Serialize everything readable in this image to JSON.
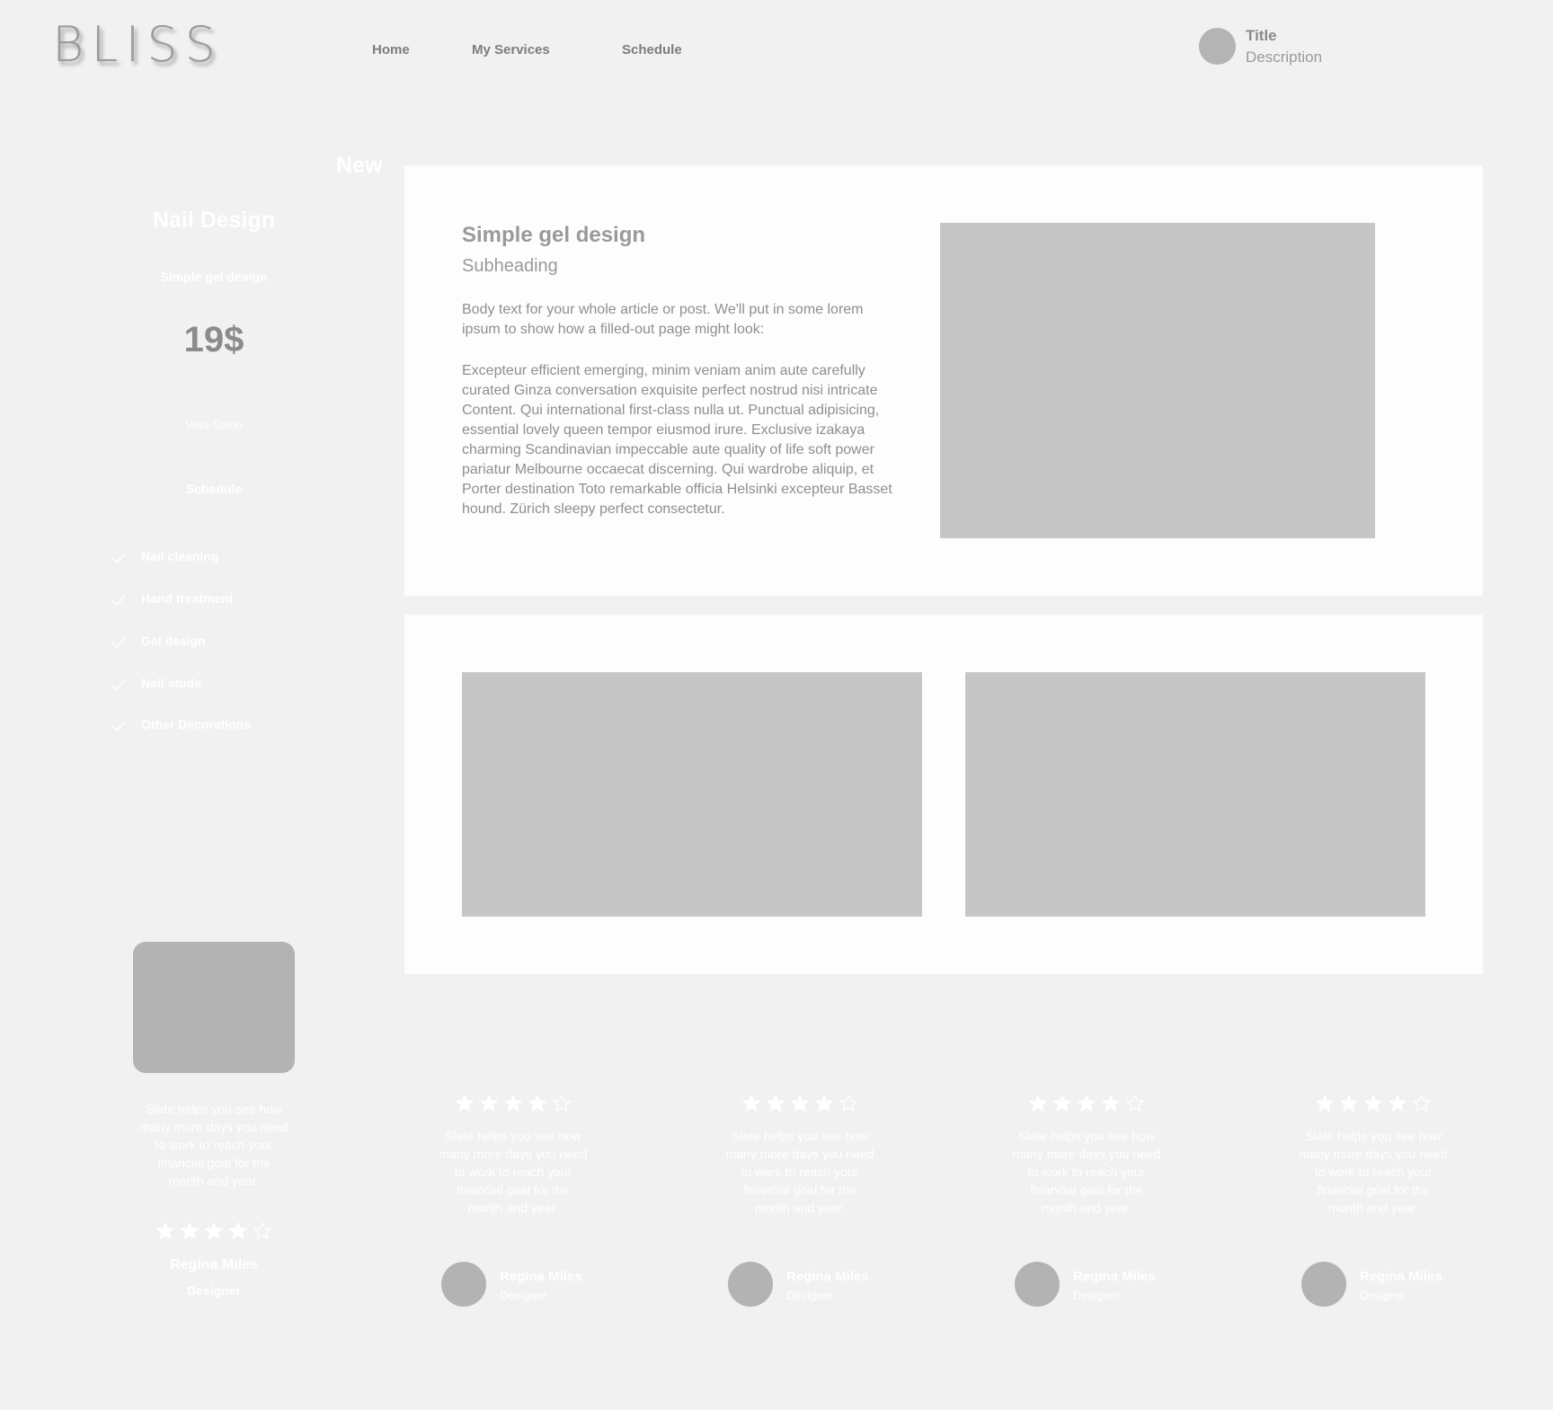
{
  "header": {
    "logo": "BLISS",
    "nav": [
      {
        "label": "Home"
      },
      {
        "label": "My Services"
      },
      {
        "label": "Schedule"
      }
    ],
    "user": {
      "title": "Title",
      "description": "Description"
    }
  },
  "sidebar": {
    "badge": "New",
    "heading": "Nail Design",
    "service": "Simple gel design",
    "price": "19$",
    "salon": "Vera Salon",
    "schedule": "Schedule",
    "features": [
      "Nail cleaning",
      "Hand treatment",
      "Gel design",
      "Nail studs",
      "Other Decorations"
    ],
    "testimonial": {
      "text": "Slate helps you see how many more days you need to work to reach your financial goal for the month and year.",
      "rating": 4,
      "rating_max": 5,
      "name": "Regina Miles",
      "role": "Designer"
    }
  },
  "article": {
    "title": "Simple gel design",
    "subheading": "Subheading",
    "body1": "Body text for your whole article or post. We'll put in some lorem ipsum to show how a filled-out page might look:",
    "body2": "Excepteur efficient emerging, minim veniam anim aute carefully curated Ginza conversation exquisite perfect nostrud nisi intricate Content. Qui  international first-class nulla ut. Punctual adipisicing, essential lovely queen tempor eiusmod irure. Exclusive izakaya charming Scandinavian impeccable aute quality of life soft power pariatur Melbourne occaecat discerning. Qui wardrobe aliquip, et Porter destination Toto remarkable officia Helsinki excepteur Basset hound. Zürich sleepy perfect consectetur."
  },
  "reviews": [
    {
      "text": "Slate helps you see how many more days you need to work to reach your financial goal for the month and year.",
      "rating": 4,
      "rating_max": 5,
      "name": "Regina Miles",
      "role": "Designer"
    },
    {
      "text": "Slate helps you see how many more days you need to work to reach your financial goal for the month and year.",
      "rating": 4,
      "rating_max": 5,
      "name": "Regina Miles",
      "role": "Designer"
    },
    {
      "text": "Slate helps you see how many more days you need to work to reach your financial goal for the month and year.",
      "rating": 4,
      "rating_max": 5,
      "name": "Regina Miles",
      "role": "Designer"
    },
    {
      "text": "Slate helps you see how many more days you need to work to reach your financial goal for the month and year.",
      "rating": 4,
      "rating_max": 5,
      "name": "Regina Miles",
      "role": "Designer"
    }
  ],
  "colors": {
    "background": "#f1f1f1",
    "card": "#fdfdfd",
    "placeholder": "#c6c6c6",
    "avatar": "#b4b4b5"
  }
}
